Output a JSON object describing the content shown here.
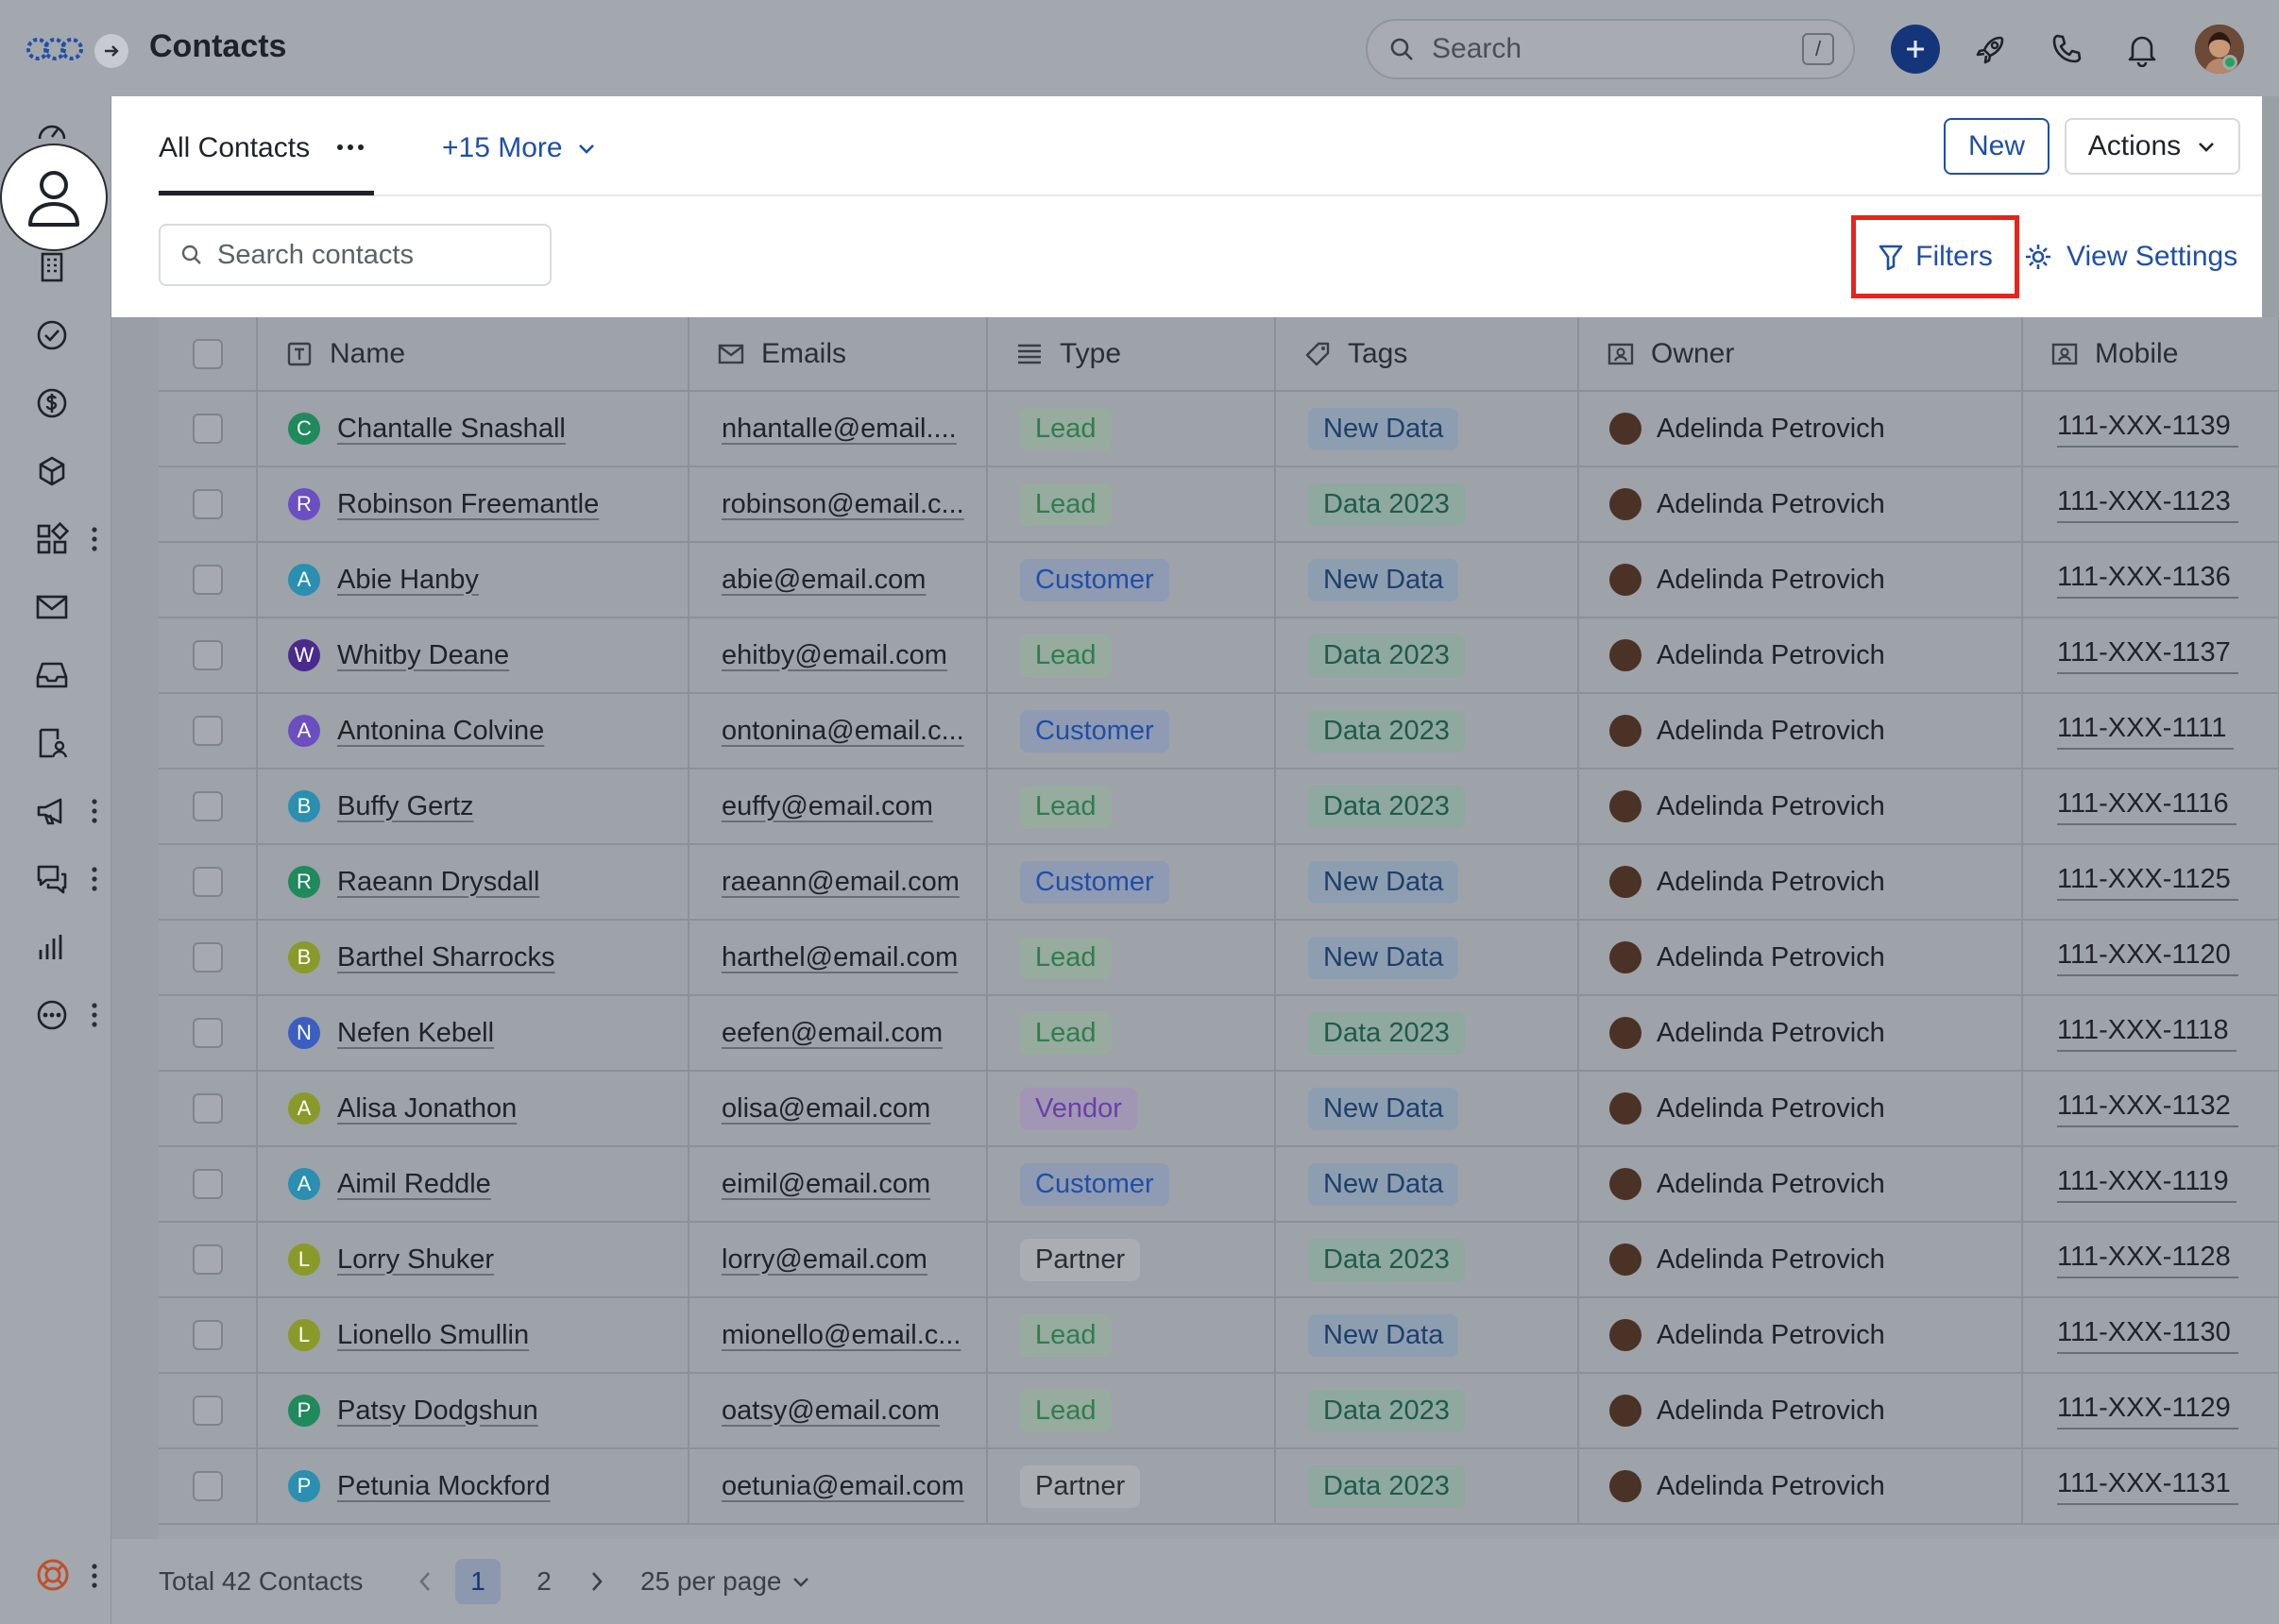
{
  "app": {
    "title": "Contacts"
  },
  "header": {
    "search_placeholder": "Search",
    "slash_hint": "/"
  },
  "views": {
    "active_tab": "All Contacts",
    "more_tab": "+15 More"
  },
  "toolbar": {
    "new_label": "New",
    "actions_label": "Actions",
    "search_placeholder": "Search contacts",
    "filters_label": "Filters",
    "view_settings_label": "View Settings"
  },
  "table": {
    "columns": [
      "Name",
      "Emails",
      "Type",
      "Tags",
      "Owner",
      "Mobile"
    ],
    "rows": [
      {
        "initial": "C",
        "initial_color": "#1f8a5c",
        "name": "Chantalle Snashall",
        "email": "nhantalle@email....",
        "type": "Lead",
        "tag": "New Data",
        "owner": "Adelinda Petrovich",
        "mobile": "111-XXX-1139"
      },
      {
        "initial": "R",
        "initial_color": "#6b4fc1",
        "name": "Robinson Freemantle",
        "email": "robinson@email.c...",
        "type": "Lead",
        "tag": "Data 2023",
        "owner": "Adelinda Petrovich",
        "mobile": "111-XXX-1123"
      },
      {
        "initial": "A",
        "initial_color": "#2a8fb0",
        "name": "Abie Hanby",
        "email": "abie@email.com",
        "type": "Customer",
        "tag": "New Data",
        "owner": "Adelinda Petrovich",
        "mobile": "111-XXX-1136"
      },
      {
        "initial": "W",
        "initial_color": "#4a2a8c",
        "name": "Whitby Deane",
        "email": "ehitby@email.com",
        "type": "Lead",
        "tag": "Data 2023",
        "owner": "Adelinda Petrovich",
        "mobile": "111-XXX-1137"
      },
      {
        "initial": "A",
        "initial_color": "#6b4fc1",
        "name": "Antonina Colvine",
        "email": "ontonina@email.c...",
        "type": "Customer",
        "tag": "Data 2023",
        "owner": "Adelinda Petrovich",
        "mobile": "111-XXX-1111"
      },
      {
        "initial": "B",
        "initial_color": "#2a8fb0",
        "name": "Buffy Gertz",
        "email": "euffy@email.com",
        "type": "Lead",
        "tag": "Data 2023",
        "owner": "Adelinda Petrovich",
        "mobile": "111-XXX-1116"
      },
      {
        "initial": "R",
        "initial_color": "#1f8a5c",
        "name": "Raeann Drysdall",
        "email": "raeann@email.com",
        "type": "Customer",
        "tag": "New Data",
        "owner": "Adelinda Petrovich",
        "mobile": "111-XXX-1125"
      },
      {
        "initial": "B",
        "initial_color": "#8a9a2a",
        "name": "Barthel Sharrocks",
        "email": "harthel@email.com",
        "type": "Lead",
        "tag": "New Data",
        "owner": "Adelinda Petrovich",
        "mobile": "111-XXX-1120"
      },
      {
        "initial": "N",
        "initial_color": "#3a5fc1",
        "name": "Nefen Kebell",
        "email": "eefen@email.com",
        "type": "Lead",
        "tag": "Data 2023",
        "owner": "Adelinda Petrovich",
        "mobile": "111-XXX-1118"
      },
      {
        "initial": "A",
        "initial_color": "#8a9a2a",
        "name": "Alisa Jonathon",
        "email": "olisa@email.com",
        "type": "Vendor",
        "tag": "New Data",
        "owner": "Adelinda Petrovich",
        "mobile": "111-XXX-1132"
      },
      {
        "initial": "A",
        "initial_color": "#2a8fb0",
        "name": "Aimil Reddle",
        "email": "eimil@email.com",
        "type": "Customer",
        "tag": "New Data",
        "owner": "Adelinda Petrovich",
        "mobile": "111-XXX-1119"
      },
      {
        "initial": "L",
        "initial_color": "#8a9a2a",
        "name": "Lorry Shuker",
        "email": "lorry@email.com",
        "type": "Partner",
        "tag": "Data 2023",
        "owner": "Adelinda Petrovich",
        "mobile": "111-XXX-1128"
      },
      {
        "initial": "L",
        "initial_color": "#8a9a2a",
        "name": "Lionello Smullin",
        "email": "mionello@email.c...",
        "type": "Lead",
        "tag": "New Data",
        "owner": "Adelinda Petrovich",
        "mobile": "111-XXX-1130"
      },
      {
        "initial": "P",
        "initial_color": "#1f8a5c",
        "name": "Patsy Dodgshun",
        "email": "oatsy@email.com",
        "type": "Lead",
        "tag": "Data 2023",
        "owner": "Adelinda Petrovich",
        "mobile": "111-XXX-1129"
      },
      {
        "initial": "P",
        "initial_color": "#2a8fb0",
        "name": "Petunia Mockford",
        "email": "oetunia@email.com",
        "type": "Partner",
        "tag": "Data 2023",
        "owner": "Adelinda Petrovich",
        "mobile": "111-XXX-1131"
      }
    ]
  },
  "pill_colors": {
    "Lead": {
      "bg": "#97ab9f",
      "fg": "#2f7d4f"
    },
    "Customer": {
      "bg": "#8f9bb3",
      "fg": "#1f4fa8"
    },
    "Vendor": {
      "bg": "#a197b5",
      "fg": "#6a3fa8"
    },
    "Partner": {
      "bg": "#aaadb2",
      "fg": "#2a2e35"
    },
    "New Data": {
      "bg": "#8e9eb1",
      "fg": "#1f3f6a"
    },
    "Data 2023": {
      "bg": "#8fa8a0",
      "fg": "#1f5a4a"
    }
  },
  "footer": {
    "total": "Total 42 Contacts",
    "pages": [
      "1",
      "2"
    ],
    "current_page": "1",
    "per_page": "25 per page"
  },
  "colors": {
    "accent": "#1f4fa8",
    "highlight": "#e8231c"
  }
}
